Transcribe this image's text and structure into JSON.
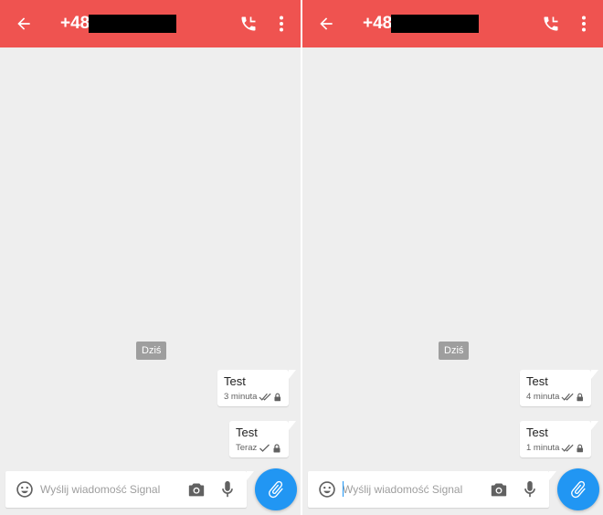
{
  "colors": {
    "toolbar": "#ef5350",
    "fab": "#2196f3",
    "background": "#eeeeee"
  },
  "panes": [
    {
      "title_prefix": "+48",
      "date_divider": "Dziś",
      "messages": [
        {
          "text": "Test",
          "time": "3 minuta",
          "status_icon": "double-check-icon",
          "secure_icon": "lock-icon"
        },
        {
          "text": "Test",
          "time": "Teraz",
          "status_icon": "check-icon",
          "secure_icon": "lock-icon"
        }
      ],
      "composer": {
        "placeholder": "Wyślij wiadomość Signal"
      }
    },
    {
      "title_prefix": "+48",
      "date_divider": "Dziś",
      "messages": [
        {
          "text": "Test",
          "time": "4 minuta",
          "status_icon": "double-check-icon",
          "secure_icon": "lock-icon"
        },
        {
          "text": "Test",
          "time": "1 minuta",
          "status_icon": "double-check-icon",
          "secure_icon": "lock-icon"
        }
      ],
      "composer": {
        "placeholder": "Wyślij wiadomość Signal"
      }
    }
  ]
}
